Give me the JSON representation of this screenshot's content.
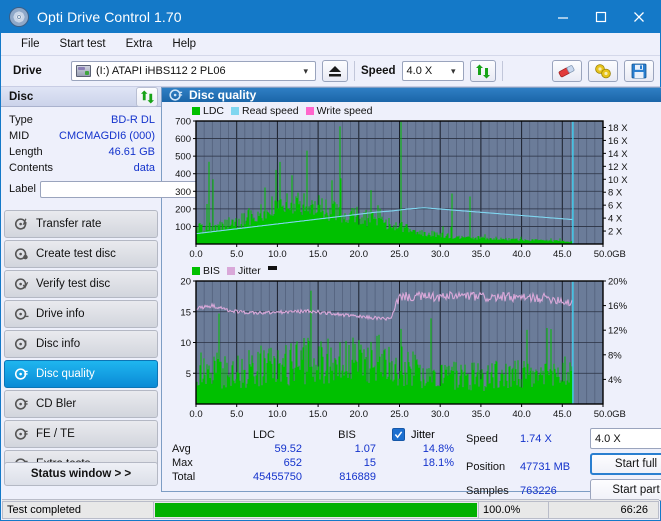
{
  "window": {
    "title": "Opti Drive Control 1.70",
    "icon": "disc-icon",
    "minimize": "minimize-icon",
    "maximize": "maximize-icon",
    "close": "close-icon"
  },
  "menu": {
    "items": [
      "File",
      "Start test",
      "Extra",
      "Help"
    ]
  },
  "toolbar": {
    "drive_label": "Drive",
    "drive_value": "(I:)   ATAPI iHBS112  2 PL06",
    "eject_icon": "eject-icon",
    "speed_label": "Speed",
    "speed_value": "4.0 X",
    "refresh_icon": "refresh-icon",
    "eraser_icon": "eraser-icon",
    "gears_icon": "gears-icon",
    "save_icon": "save-icon"
  },
  "disc_panel": {
    "title": "Disc",
    "refresh_icon": "refresh-icon",
    "rows": [
      {
        "key": "Type",
        "value": "BD-R DL"
      },
      {
        "key": "MID",
        "value": "CMCMAGDI6 (000)"
      },
      {
        "key": "Length",
        "value": "46.61 GB"
      },
      {
        "key": "Contents",
        "value": "data"
      }
    ],
    "label_key": "Label",
    "label_value": "",
    "label_placeholder": "",
    "disc_icon": "disc-icon"
  },
  "sidebar": {
    "items": [
      {
        "label": "Transfer rate",
        "icon": "disc-arrow-icon",
        "active": false
      },
      {
        "label": "Create test disc",
        "icon": "disc-write-icon",
        "active": false
      },
      {
        "label": "Verify test disc",
        "icon": "disc-check-icon",
        "active": false
      },
      {
        "label": "Drive info",
        "icon": "disc-info-icon",
        "active": false
      },
      {
        "label": "Disc info",
        "icon": "disc-info-icon",
        "active": false
      },
      {
        "label": "Disc quality",
        "icon": "disc-quality-icon",
        "active": true
      },
      {
        "label": "CD Bler",
        "icon": "disc-bler-icon",
        "active": false
      },
      {
        "label": "FE / TE",
        "icon": "disc-fete-icon",
        "active": false
      },
      {
        "label": "Extra tests",
        "icon": "disc-extra-icon",
        "active": false
      }
    ],
    "status_window_label": "Status window > >"
  },
  "main": {
    "title": "Disc quality",
    "title_icon": "disc-quality-icon"
  },
  "chart_data": [
    {
      "id": "ldc-chart",
      "type": "area",
      "title": "",
      "xlabel": "GB",
      "ylabel": "",
      "xlim": [
        0,
        50
      ],
      "ylim": [
        0,
        700
      ],
      "y2lim": [
        0,
        19
      ],
      "grid": true,
      "legend_position": "top-left",
      "legend": [
        {
          "name": "LDC",
          "color": "#00c000"
        },
        {
          "name": "Read speed",
          "color": "#7fd6f0"
        },
        {
          "name": "Write speed",
          "color": "#ff66cc"
        }
      ],
      "xticks": [
        "0.0",
        "5.0",
        "10.0",
        "15.0",
        "20.0",
        "25.0",
        "30.0",
        "35.0",
        "40.0",
        "45.0",
        "50.0"
      ],
      "xtick_unit": "GB",
      "yticks": [
        700,
        600,
        500,
        400,
        300,
        200,
        100
      ],
      "y2ticks": [
        "18 X",
        "16 X",
        "14 X",
        "12 X",
        "10 X",
        "8 X",
        "6 X",
        "4 X",
        "2 X"
      ],
      "series": [
        {
          "name": "LDC",
          "color": "#00c000",
          "x": [
            0.0,
            0.5,
            1.0,
            1.5,
            2.0,
            2.5,
            3.0,
            3.5,
            4.0,
            4.5,
            5.0,
            5.5,
            6.0,
            6.5,
            7.0,
            7.5,
            8.0,
            8.5,
            9.0,
            9.5,
            10.0,
            10.5,
            11.0,
            11.5,
            12.0,
            12.5,
            13.0,
            13.5,
            14.0,
            14.5,
            15.0,
            15.5,
            16.0,
            16.5,
            17.0,
            17.5,
            18.0,
            18.5,
            19.0,
            19.5,
            20.0,
            20.5,
            21.0,
            21.5,
            22.0,
            22.5,
            23.0,
            23.5,
            24.0,
            24.5,
            25.0,
            25.5,
            26.0,
            26.5,
            27.0,
            27.5,
            28.0,
            28.5,
            29.0,
            29.5,
            30.0,
            30.5,
            31.0,
            31.5,
            32.0,
            32.5,
            33.0,
            33.5,
            34.0,
            34.5,
            35.0,
            35.5,
            36.0,
            36.5,
            37.0,
            37.5,
            38.0,
            38.5,
            39.0,
            39.5,
            40.0,
            40.5,
            41.0,
            41.5,
            42.0,
            42.5,
            43.0,
            43.5,
            44.0,
            44.5,
            45.0,
            45.5,
            46.0,
            46.3
          ],
          "values": [
            95,
            110,
            105,
            120,
            115,
            125,
            120,
            135,
            140,
            150,
            160,
            155,
            175,
            190,
            180,
            210,
            230,
            215,
            245,
            250,
            260,
            255,
            270,
            265,
            275,
            270,
            280,
            275,
            265,
            260,
            255,
            250,
            240,
            235,
            230,
            225,
            220,
            215,
            205,
            200,
            195,
            185,
            180,
            170,
            165,
            155,
            150,
            140,
            135,
            125,
            120,
            110,
            105,
            95,
            90,
            85,
            80,
            75,
            70,
            65,
            62,
            60,
            58,
            55,
            52,
            50,
            48,
            46,
            44,
            42,
            40,
            38,
            37,
            36,
            35,
            34,
            33,
            32,
            31,
            30,
            29,
            28,
            27,
            26,
            25,
            24,
            23,
            22,
            21,
            20,
            19,
            18,
            17,
            16
          ]
        },
        {
          "name": "Read speed",
          "color": "#7fd6f0",
          "x": [
            0.0,
            2.0,
            4.0,
            6.0,
            8.0,
            10.0,
            12.0,
            14.0,
            16.0,
            18.0,
            20.0,
            22.0,
            24.0,
            26.0,
            28.0,
            30.0,
            32.0,
            34.0,
            36.0,
            38.0,
            40.0,
            42.0,
            44.0,
            46.0
          ],
          "values_x": [
            1.6,
            1.9,
            2.2,
            2.5,
            2.8,
            3.1,
            3.4,
            3.7,
            4.0,
            4.3,
            4.6,
            4.9,
            5.1,
            5.4,
            5.6,
            5.4,
            5.2,
            5.0,
            4.8,
            4.6,
            4.4,
            4.2,
            4.0,
            3.8
          ]
        }
      ],
      "marker_line_x": 46.3,
      "marker_color": "#40d0f0"
    },
    {
      "id": "bis-chart",
      "type": "area",
      "title": "",
      "xlabel": "GB",
      "xlim": [
        0,
        50
      ],
      "ylim": [
        0,
        20
      ],
      "y2lim": [
        0,
        20
      ],
      "grid": true,
      "legend_position": "top-left",
      "legend": [
        {
          "name": "BIS",
          "color": "#00c000"
        },
        {
          "name": "Jitter",
          "color": "#d9a8d9"
        }
      ],
      "xticks": [
        "0.0",
        "5.0",
        "10.0",
        "15.0",
        "20.0",
        "25.0",
        "30.0",
        "35.0",
        "40.0",
        "45.0",
        "50.0"
      ],
      "xtick_unit": "GB",
      "yticks": [
        20,
        15,
        10,
        5
      ],
      "y2ticks": [
        "20%",
        "16%",
        "12%",
        "8%",
        "4%"
      ],
      "series": [
        {
          "name": "BIS",
          "color": "#00c000",
          "x": [
            0,
            1,
            2,
            3,
            4,
            5,
            6,
            7,
            8,
            9,
            10,
            11,
            12,
            13,
            14,
            15,
            16,
            17,
            18,
            19,
            20,
            21,
            22,
            23,
            24,
            25,
            26,
            27,
            28,
            29,
            30,
            31,
            32,
            33,
            34,
            35,
            36,
            37,
            38,
            39,
            40,
            41,
            42,
            43,
            44,
            45,
            46
          ],
          "values": [
            7,
            7,
            7,
            7,
            7,
            7,
            7,
            8,
            8,
            8,
            8,
            8,
            9,
            9,
            9,
            9,
            9,
            9,
            9,
            9,
            9,
            9,
            10,
            9,
            9,
            8,
            8,
            7,
            7,
            7,
            6,
            6,
            6,
            6,
            6,
            6,
            6,
            6,
            6,
            6,
            6,
            6,
            6,
            6,
            6,
            7,
            7
          ]
        },
        {
          "name": "Jitter",
          "color": "#d9a8d9",
          "x": [
            0,
            2,
            4,
            6,
            8,
            10,
            12,
            14,
            16,
            18,
            20,
            22,
            24,
            25,
            26,
            28,
            30,
            32,
            34,
            36,
            38,
            40,
            42,
            44,
            46
          ],
          "values": [
            15.5,
            16.0,
            15.2,
            14.9,
            14.8,
            14.9,
            15.0,
            15.1,
            14.8,
            14.5,
            14.2,
            14.0,
            13.8,
            17.6,
            17.4,
            17.5,
            17.3,
            17.6,
            17.5,
            17.3,
            17.4,
            17.2,
            17.3,
            17.1,
            16.5
          ]
        }
      ],
      "marker_line_x": 46.3,
      "marker_color": "#40d0f0"
    }
  ],
  "stats": {
    "headers": {
      "ldc": "LDC",
      "bis": "BIS",
      "jitter": "Jitter"
    },
    "jitter_checked": true,
    "rows": [
      {
        "label": "Avg",
        "ldc": "59.52",
        "bis": "1.07",
        "jitter": "14.8%"
      },
      {
        "label": "Max",
        "ldc": "652",
        "bis": "15",
        "jitter": "18.1%"
      },
      {
        "label": "Total",
        "ldc": "45455750",
        "bis": "816889",
        "jitter": ""
      }
    ]
  },
  "run_info": {
    "speed_label": "Speed",
    "speed_value": "1.74 X",
    "position_label": "Position",
    "position_value": "47731 MB",
    "samples_label": "Samples",
    "samples_value": "763226",
    "speed_select": "4.0 X",
    "start_full": "Start full",
    "start_part": "Start part"
  },
  "statusbar": {
    "message": "Test completed",
    "progress_percent": 100.0,
    "progress_text": "100.0%",
    "elapsed": "66:26",
    "progress_color": "#00b000"
  }
}
